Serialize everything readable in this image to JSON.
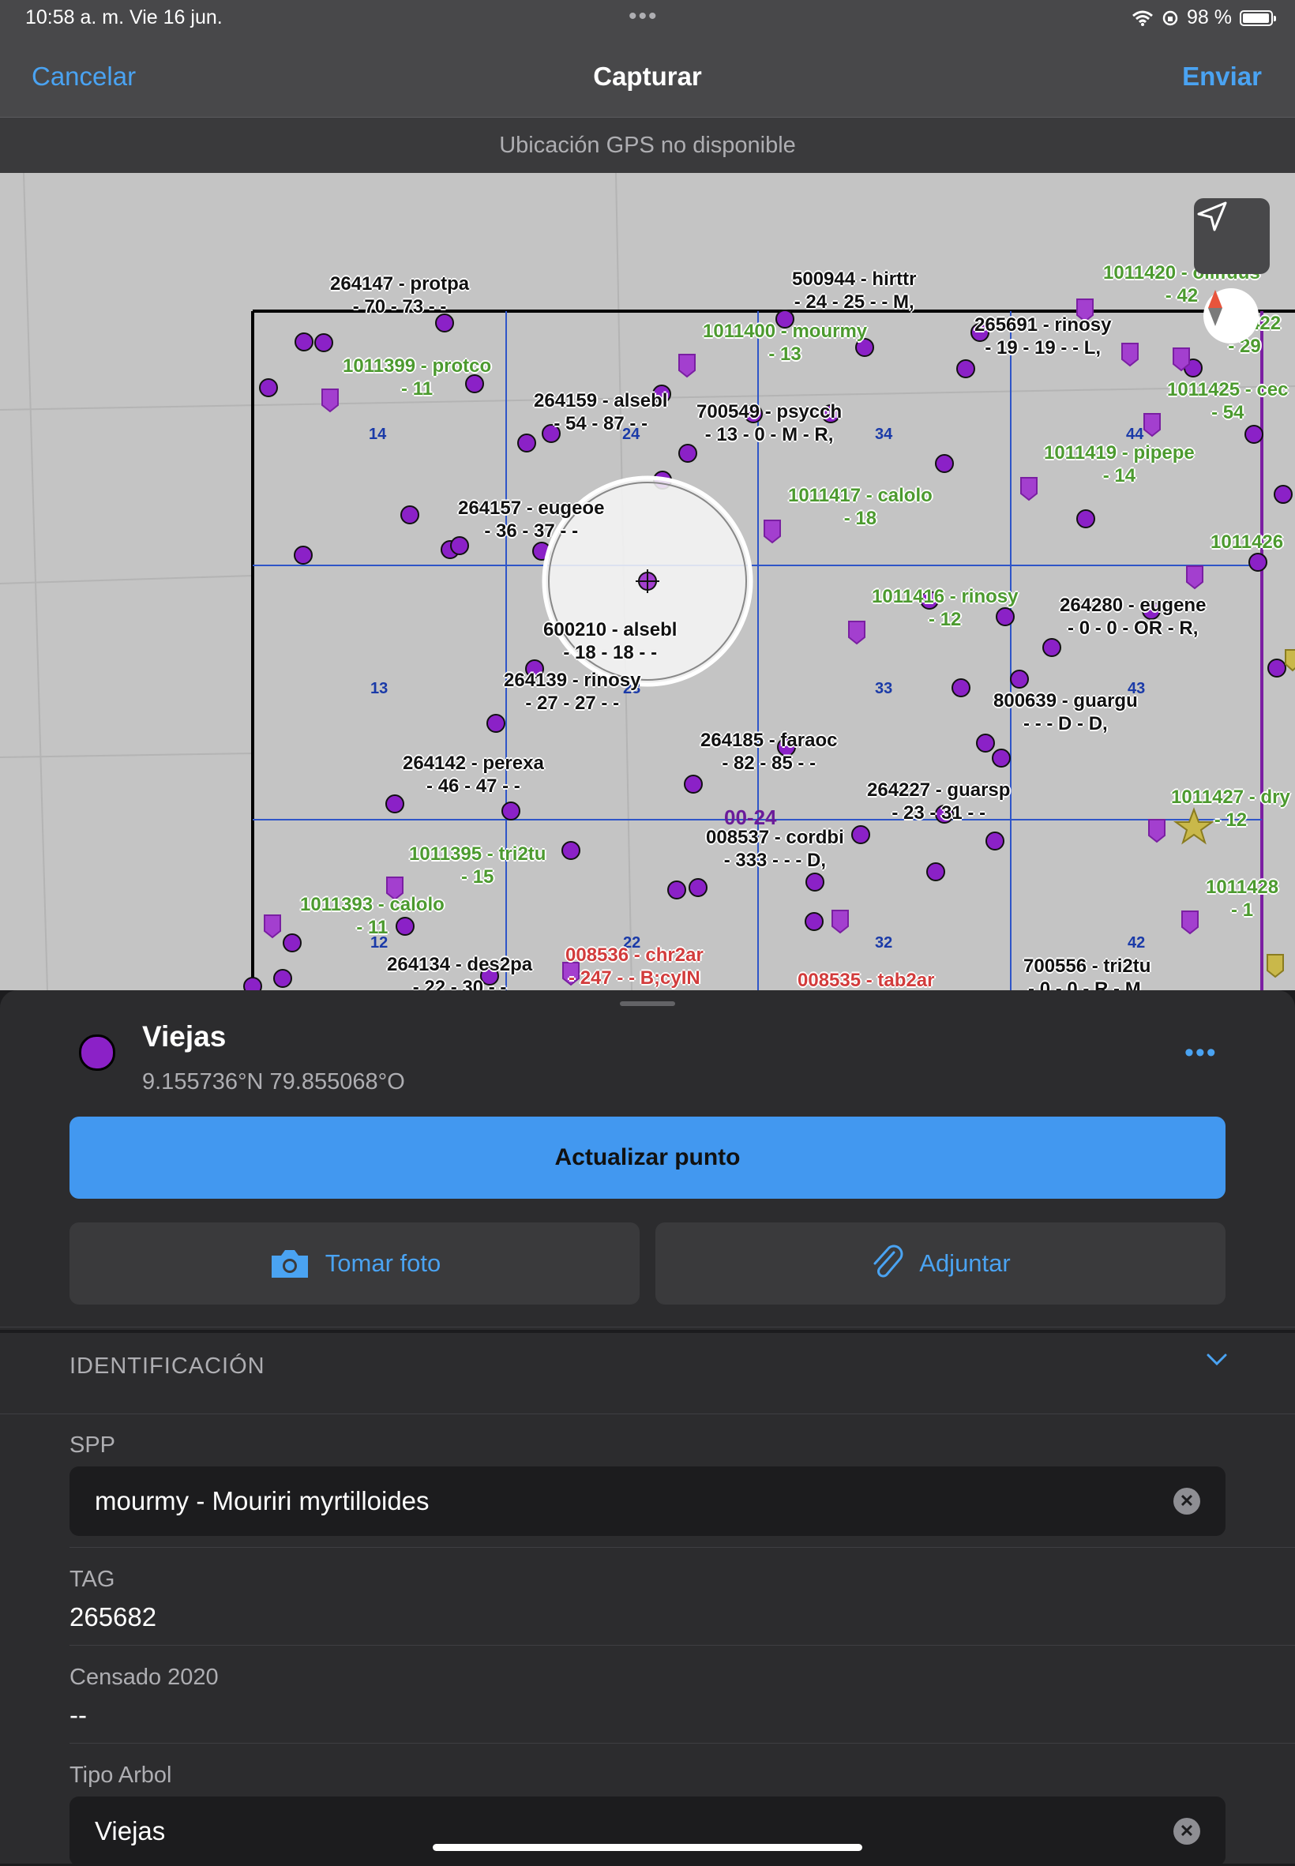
{
  "status_bar": {
    "time": "10:58 a. m.   Vie 16 jun.",
    "battery": "98 %",
    "battery_fraction": 0.98,
    "multitask_dots": "•••"
  },
  "nav": {
    "cancel": "Cancelar",
    "title": "Capturar",
    "send": "Enviar"
  },
  "gps_status": "Ubicación GPS no disponible",
  "map": {
    "tree_labels": [
      {
        "l1": "264147 - protpa",
        "l2": "- 70 - 73 -  -",
        "color": "k"
      },
      {
        "l1": "500944 - hirttr",
        "l2": "- 24 - 25 -  - M,",
        "color": "k"
      },
      {
        "l1": "1011420 - ollifuus",
        "l2": "- 42",
        "color": "g"
      },
      {
        "l1": "1011400 - mourmy",
        "l2": "- 13",
        "color": "g"
      },
      {
        "l1": "265691 - rinosy",
        "l2": "- 19 - 19 -  - L,",
        "color": "k"
      },
      {
        "l1": "1011399 - protco",
        "l2": "- 11",
        "color": "g"
      },
      {
        "l1": "264159 - alsebl",
        "l2": "- 54 - 87 -  -",
        "color": "k"
      },
      {
        "l1": "700549 - psycch",
        "l2": "- 13 - 0 - M - R,",
        "color": "k"
      },
      {
        "l1": "1011425 - cec",
        "l2": "- 54",
        "color": "g"
      },
      {
        "l1": "1011419 - pipepe",
        "l2": "- 14",
        "color": "g"
      },
      {
        "l1": "264157 - eugeoe",
        "l2": "- 36 - 37 -  -",
        "color": "k"
      },
      {
        "l1": "1011417 - calolo",
        "l2": "- 18",
        "color": "g"
      },
      {
        "l1": "1011426",
        "l2": "",
        "color": "g"
      },
      {
        "l1": "1011416 - rinosy",
        "l2": "- 12",
        "color": "g"
      },
      {
        "l1": "264280 - eugene",
        "l2": "- 0 - 0 - OR - R,",
        "color": "k"
      },
      {
        "l1": "600210 - alsebl",
        "l2": "- 18 - 18 -  -",
        "color": "k"
      },
      {
        "l1": "264139 - rinosy",
        "l2": "- 27 - 27 -  -",
        "color": "k"
      },
      {
        "l1": "800639 - guargu",
        "l2": "-  -  - D - D,",
        "color": "k"
      },
      {
        "l1": "264185 - faraoc",
        "l2": "- 82 - 85 -  -",
        "color": "k"
      },
      {
        "l1": "264142 - perexa",
        "l2": "- 46 - 47 -  -",
        "color": "k"
      },
      {
        "l1": "264227 - guarsp",
        "l2": "- 23 - 31 -  -",
        "color": "k"
      },
      {
        "l1": "1011427 - dry",
        "l2": "- 12",
        "color": "g"
      },
      {
        "l1": "008537 - cordbi",
        "l2": "- 333 -  -  - D,",
        "color": "k"
      },
      {
        "l1": "1011395 - tri2tu",
        "l2": "- 15",
        "color": "g"
      },
      {
        "l1": "1011393 - calolo",
        "l2": "- 11",
        "color": "g"
      },
      {
        "l1": "1011428",
        "l2": "- 1",
        "color": "g"
      },
      {
        "l1": "264134 - des2pa",
        "l2": "- 22 - 30 -  -",
        "color": "k"
      },
      {
        "l1": "008536 - chr2ar",
        "l2": "- 247 -  - B;cyIN",
        "color": "r"
      },
      {
        "l1": "008535 - tab2ar",
        "l2": "",
        "color": "r"
      },
      {
        "l1": "700556 - tri2tu",
        "l2": "- 0 - 0 - R - M,",
        "color": "k"
      },
      {
        "l1": "1011422",
        "l2": "- 29",
        "color": "g"
      }
    ],
    "quadrat_numbers": [
      "14",
      "24",
      "34",
      "44",
      "13",
      "23",
      "33",
      "43",
      "12",
      "22",
      "32",
      "42"
    ],
    "quadrat_label": "00-24"
  },
  "point": {
    "name": "Viejas",
    "color": "#8b21c7",
    "coords": "9.155736°N  79.855068°O",
    "more": "•••"
  },
  "actions": {
    "update": "Actualizar punto",
    "photo": "Tomar foto",
    "attach": "Adjuntar"
  },
  "section": {
    "title": "IDENTIFICACIÓN"
  },
  "fields": {
    "spp_label": "SPP",
    "spp_value": "mourmy - Mouriri myrtilloides",
    "tag_label": "TAG",
    "tag_value": "265682",
    "censo_label": "Censado 2020",
    "censo_value": "--",
    "tipo_label": "Tipo Arbol",
    "tipo_value": "Viejas"
  },
  "colors": {
    "accent": "#4aa3f2",
    "primary_button": "#4298f0",
    "tree_point": "#8b21c7"
  }
}
